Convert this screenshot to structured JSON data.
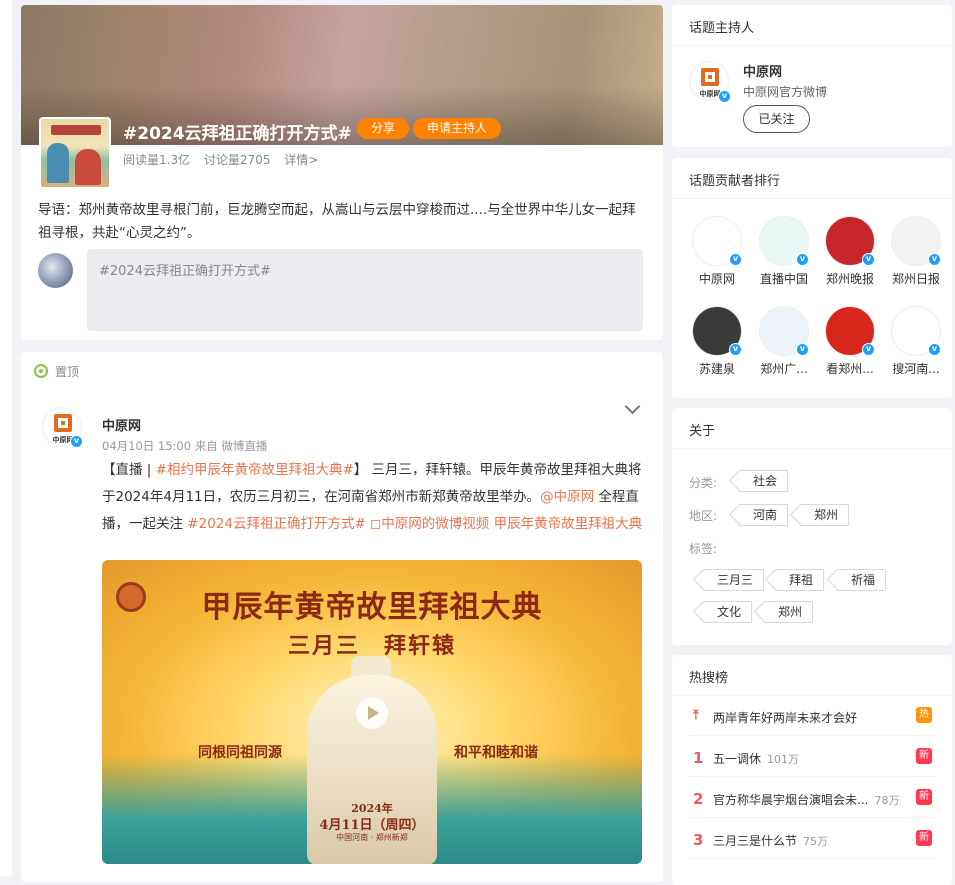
{
  "topic": {
    "title": "#2024云拜祖正确打开方式#",
    "share_label": "分享",
    "apply_host_label": "申请主持人",
    "reads": "阅读量1.3亿",
    "discussions": "讨论量2705",
    "details_label": "详情>",
    "guide_text": "导语：郑州黄帝故里寻根门前，巨龙腾空而起，从嵩山与云层中穿梭而过....与全世界中华儿女一起拜祖寻根，共赴“心灵之约”。",
    "post_placeholder": "#2024云拜祖正确打开方式#"
  },
  "feed": {
    "pinned_label": "置顶",
    "post": {
      "author": "中原网",
      "logo_text": "中原网",
      "time": "04月10日 15:00",
      "source": "来自 微博直播",
      "text_prefix": "【直播 | ",
      "link1": "#相约甲辰年黄帝故里拜祖大典#",
      "text_mid1": "】 三月三，拜轩辕。甲辰年黄帝故里拜祖大典将于2024年4月11日，农历三月初三，在河南省郑州市新郑黄帝故里举办。",
      "mention": "@中原网",
      "text_mid2": " 全程直播，一起关注 ",
      "link2": "#2024云拜祖正确打开方式#",
      "link3": " ◻中原网的微博视频",
      "link4": " 甲辰年黄帝故里拜祖大典",
      "poster": {
        "title": "甲辰年黄帝故里拜祖大典",
        "subtitle": "三月三　拜轩辕",
        "left_slogan": "同根同祖同源",
        "right_slogan": "和平和睦和谐",
        "year": "2024年",
        "date": "4月11日（周四）",
        "location": "中国河南 · 郑州新郑"
      }
    }
  },
  "host_card": {
    "title": "话题主持人",
    "name": "中原网",
    "desc": "中原网官方微博",
    "follow_label": "已关注"
  },
  "contributors": {
    "title": "话题贡献者排行",
    "items": [
      {
        "name": "中原网",
        "color": "#ffffff"
      },
      {
        "name": "直播中国",
        "color": "#e8f6f4"
      },
      {
        "name": "郑州晚报",
        "color": "#c8252c"
      },
      {
        "name": "郑州日报",
        "color": "#f4f1f1"
      },
      {
        "name": "苏建泉",
        "color": "#3a3a3a"
      },
      {
        "name": "郑州广...",
        "color": "#eef3fb"
      },
      {
        "name": "看郑州...",
        "color": "#d9261c"
      },
      {
        "name": "搜河南...",
        "color": "#ffffff"
      }
    ]
  },
  "about": {
    "title": "关于",
    "category_label": "分类:",
    "categories": [
      "社会"
    ],
    "region_label": "地区:",
    "regions": [
      "河南",
      "郑州"
    ],
    "tags_label": "标签:",
    "tags": [
      "三月三",
      "拜祖",
      "祈福",
      "文化",
      "郑州"
    ]
  },
  "hot": {
    "title": "热搜榜",
    "items": [
      {
        "rank": "",
        "text": "两岸青年好两岸未来才会好",
        "count": "",
        "badge": "热",
        "badge_color": "#ff9406"
      },
      {
        "rank": "1",
        "text": "五一调休",
        "count": "101万",
        "badge": "新",
        "badge_color": "#ff3852"
      },
      {
        "rank": "2",
        "text": "官方称华晨宇烟台演唱会未...",
        "count": "78万",
        "badge": "新",
        "badge_color": "#ff3852"
      },
      {
        "rank": "3",
        "text": "三月三是什么节",
        "count": "75万",
        "badge": "新",
        "badge_color": "#ff3852"
      }
    ]
  }
}
